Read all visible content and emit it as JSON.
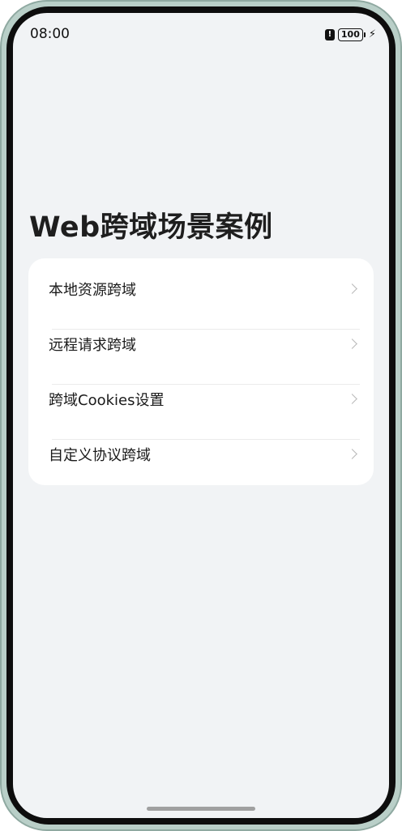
{
  "status_bar": {
    "time": "08:00",
    "alert_icon": "exclamation-icon",
    "battery_level": "100",
    "charging_icon": "lightning-bolt-icon"
  },
  "page": {
    "title": "Web跨域场景案例"
  },
  "list": {
    "items": [
      {
        "label": "本地资源跨域",
        "icon": "chevron-right-icon"
      },
      {
        "label": "远程请求跨域",
        "icon": "chevron-right-icon"
      },
      {
        "label": "跨域Cookies设置",
        "icon": "chevron-right-icon"
      },
      {
        "label": "自定义协议跨域",
        "icon": "chevron-right-icon"
      }
    ]
  },
  "colors": {
    "background": "#f1f3f5",
    "card": "#ffffff",
    "title_text": "#1e1e1e",
    "chevron": "#b8b8b8",
    "frame": "#b9cfc8"
  }
}
